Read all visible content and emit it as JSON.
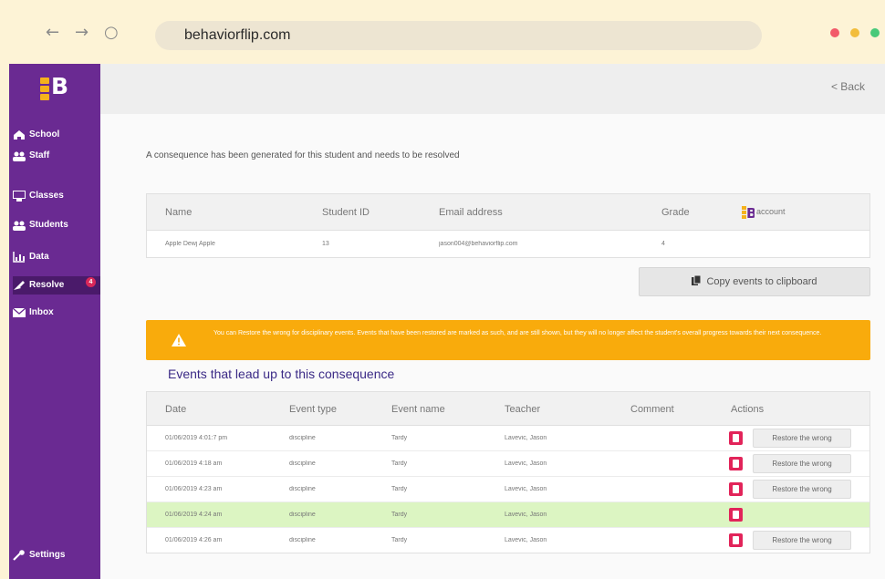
{
  "browser": {
    "url": "behaviorflip.com",
    "back_glyph": "←",
    "forward_glyph": "→",
    "reload_glyph": "○",
    "dots": [
      "#f25a6a",
      "#f2bd3c",
      "#48c97a"
    ]
  },
  "sidebar": {
    "logo_letter": "B",
    "items": [
      {
        "label": "School",
        "icon": "school-icon"
      },
      {
        "label": "Staff",
        "icon": "staff-icon"
      },
      {
        "label": "Classes",
        "icon": "classes-icon"
      },
      {
        "label": "Students",
        "icon": "students-icon"
      },
      {
        "label": "Data",
        "icon": "data-icon"
      },
      {
        "label": "Resolve",
        "icon": "resolve-icon",
        "active": true,
        "badge": "4"
      },
      {
        "label": "Inbox",
        "icon": "inbox-icon"
      }
    ],
    "settings_label": "Settings"
  },
  "topbar": {
    "back_label": "< Back"
  },
  "intro_text": "A consequence has been generated for this student and needs to be resolved",
  "student_table": {
    "headers": [
      "Name",
      "Student ID",
      "Email address",
      "Grade",
      "account"
    ],
    "row": [
      "Apple Dewj Apple",
      "13",
      "jason004@behaviorflip.com",
      "4",
      ""
    ]
  },
  "copy_button_label": "Copy events to clipboard",
  "warning_text": "You can Restore the wrong for disciplinary events. Events that have been restored are marked as such, and are still shown, but they will no longer affect the student's overall progress towards their next consequence.",
  "events_title": "Events that lead up to this consequence",
  "events_table": {
    "headers": [
      "Date",
      "Event type",
      "Event name",
      "Teacher",
      "Comment",
      "Actions"
    ],
    "rows": [
      {
        "date": "01/06/2019 4:01:7 pm",
        "type": "discipline",
        "name": "Tardy",
        "teacher": "Lavevic, Jason",
        "comment": "",
        "restore": "Restore the wrong"
      },
      {
        "date": "01/06/2019 4:18 am",
        "type": "discipline",
        "name": "Tardy",
        "teacher": "Lavevic, Jason",
        "comment": "",
        "restore": "Restore the wrong"
      },
      {
        "date": "01/06/2019 4:23 am",
        "type": "discipline",
        "name": "Tardy",
        "teacher": "Lavevic, Jason",
        "comment": "",
        "restore": "Restore the wrong"
      },
      {
        "date": "01/06/2019 4:24 am",
        "type": "discipline",
        "name": "Tardy",
        "teacher": "Lavevic, Jason",
        "comment": "",
        "restore": "",
        "highlight": true
      },
      {
        "date": "01/06/2019 4:26 am",
        "type": "discipline",
        "name": "Tardy",
        "teacher": "Lavevic, Jason",
        "comment": "",
        "restore": "Restore the wrong"
      }
    ]
  },
  "colors": {
    "sidebar": "#6a2a92",
    "accent_orange": "#f9ab0c",
    "delete_red": "#e2245a",
    "highlight_row": "#dcf5c2"
  }
}
